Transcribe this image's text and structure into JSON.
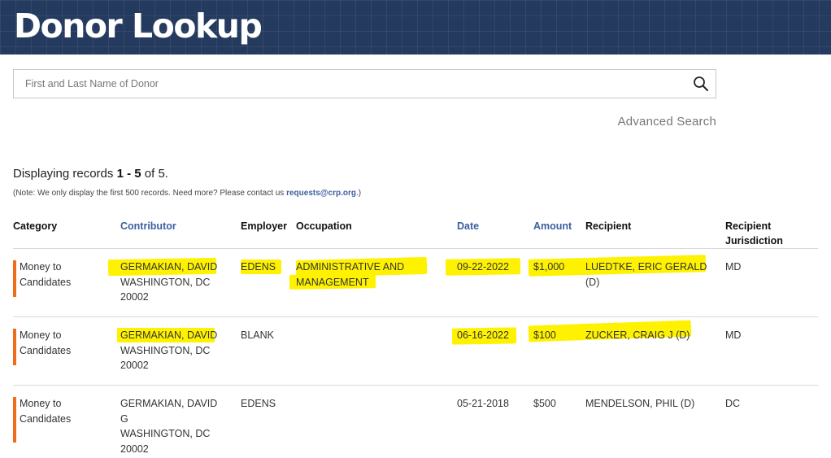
{
  "header": {
    "title": "Donor Lookup"
  },
  "search": {
    "placeholder": "First and Last Name of Donor",
    "value": "",
    "icon": "search-icon"
  },
  "advanced_search": "Advanced Search",
  "summary": {
    "prefix": "Displaying records",
    "range": "1 - 5",
    "of": "of",
    "total": "5",
    "suffix": "."
  },
  "note": {
    "text": "(Note: We only display the first 500 records. Need more? Please contact us",
    "email": "requests@crp.org",
    "close": ".)"
  },
  "columns": {
    "category": "Category",
    "contributor": "Contributor",
    "employer": "Employer",
    "occupation": "Occupation",
    "date": "Date",
    "amount": "Amount",
    "recipient": "Recipient",
    "jurisdiction_1": "Recipient",
    "jurisdiction_2": "Jurisdiction"
  },
  "rows": [
    {
      "category": [
        "Money to",
        "Candidates"
      ],
      "contributor": [
        "GERMAKIAN, DAVID",
        "WASHINGTON, DC",
        "20002"
      ],
      "employer": "EDENS",
      "occupation": [
        "ADMINISTRATIVE AND",
        "MANAGEMENT"
      ],
      "date": "09-22-2022",
      "amount": "$1,000",
      "recipient": [
        "LUEDTKE, ERIC GERALD",
        "(D)"
      ],
      "jurisdiction": "MD"
    },
    {
      "category": [
        "Money to",
        "Candidates"
      ],
      "contributor": [
        "GERMAKIAN, DAVID",
        "WASHINGTON, DC",
        "20002"
      ],
      "employer": "BLANK",
      "occupation": [],
      "date": "06-16-2022",
      "amount": "$100",
      "recipient": [
        "ZUCKER, CRAIG J (D)"
      ],
      "jurisdiction": "MD"
    },
    {
      "category": [
        "Money to",
        "Candidates"
      ],
      "contributor": [
        "GERMAKIAN, DAVID",
        "G",
        "WASHINGTON, DC",
        "20002"
      ],
      "employer": "EDENS",
      "occupation": [],
      "date": "05-21-2018",
      "amount": "$500",
      "recipient": [
        "MENDELSON, PHIL (D)"
      ],
      "jurisdiction": "DC"
    }
  ],
  "colors": {
    "banner": "#243a5e",
    "link": "#3b5fa0",
    "category_bar": "#ef6c1d",
    "highlight": "#fff200"
  }
}
